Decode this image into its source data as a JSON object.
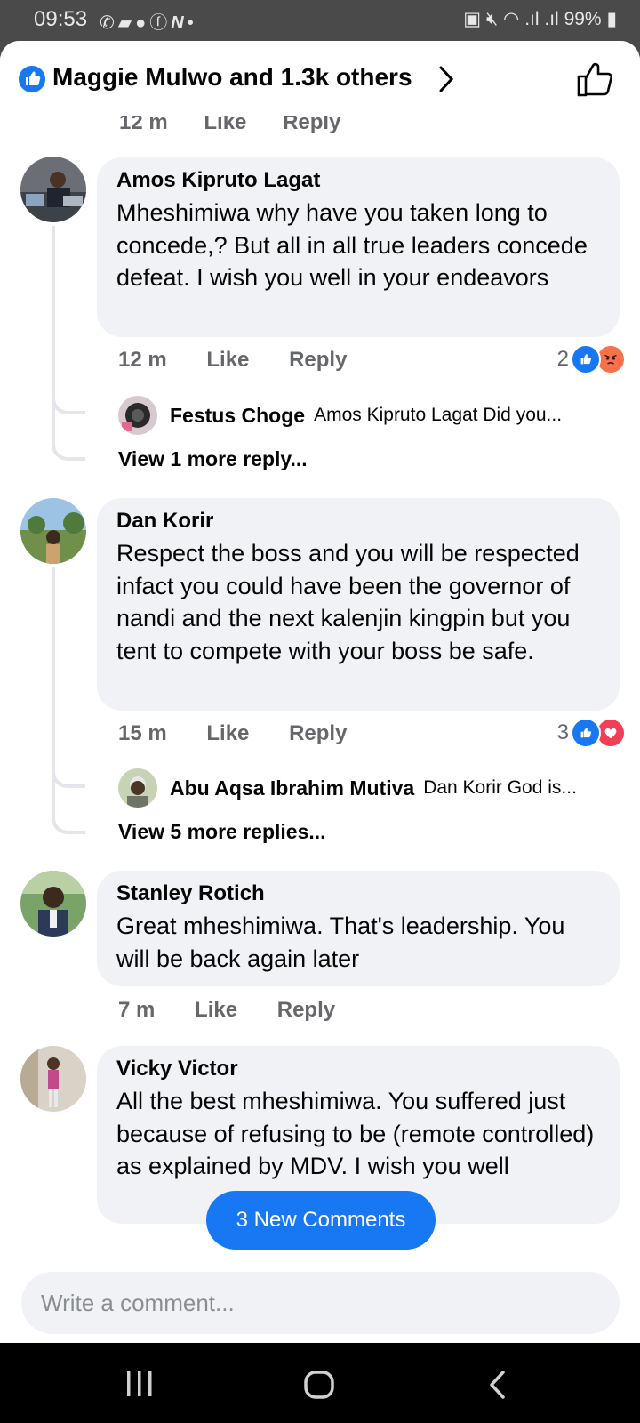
{
  "status_bar": {
    "time": "09:53",
    "left_icons": [
      "whatsapp-icon",
      "message-icon",
      "chat-icon",
      "facebook-icon",
      "n-icon",
      "dot-icon"
    ],
    "right_icons": [
      "lock-icon",
      "mute-icon",
      "wifi-icon",
      "signal-icon"
    ],
    "battery": "99%"
  },
  "header": {
    "title": "Maggie Mulwo and 1.3k others"
  },
  "partial_row": {
    "time": "12 m",
    "like": "Like",
    "reply": "Reply"
  },
  "comments": [
    {
      "name": "Amos Kipruto Lagat",
      "text": "Mheshimiwa why have you taken long to concede,? But all in all true leaders concede defeat. I wish you well in your endeavors",
      "time": "12 m",
      "like": "Like",
      "reply": "Reply",
      "reaction_count": "2",
      "reactions": [
        "like",
        "angry"
      ],
      "reply_preview": {
        "name": "Festus Choge",
        "text": "Amos Kipruto Lagat Did you..."
      },
      "more_replies": "View 1 more reply..."
    },
    {
      "name": "Dan Korir",
      "text": "Respect the boss and you will be respected infact you could have been the governor of nandi and the next kalenjin kingpin but you tent to compete with your boss be safe.",
      "time": "15 m",
      "like": "Like",
      "reply": "Reply",
      "reaction_count": "3",
      "reactions": [
        "like",
        "love"
      ],
      "reply_preview": {
        "name": "Abu Aqsa Ibrahim Mutiva",
        "text": "Dan Korir God is..."
      },
      "more_replies": "View 5 more replies..."
    },
    {
      "name": "Stanley Rotich",
      "text": "Great mheshimiwa. That's leadership. You will be back again later",
      "time": "7 m",
      "like": "Like",
      "reply": "Reply"
    },
    {
      "name": "Vicky Victor",
      "text": "All the best mheshimiwa. You suffered just because of refusing to be (remote controlled) as explained by MDV. I wish you well"
    }
  ],
  "new_comments_button": "3 New Comments",
  "composer": {
    "placeholder": "Write a comment..."
  },
  "colors": {
    "brand": "#1877f2",
    "bubble": "#f0f2f5",
    "angry": "#f7714a",
    "love": "#f33e58",
    "muted_text": "#65676b"
  }
}
